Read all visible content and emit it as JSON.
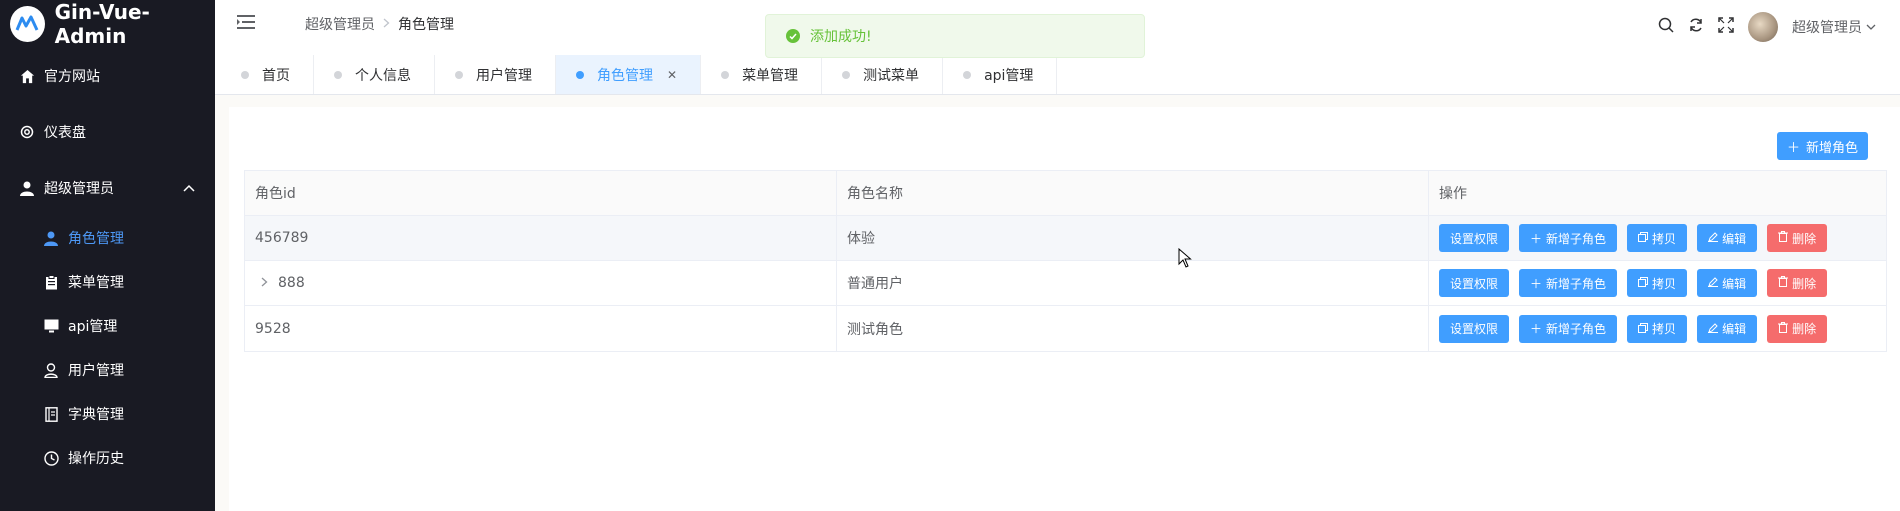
{
  "app": {
    "title": "Gin-Vue-Admin"
  },
  "sidebar": {
    "items": [
      {
        "label": "官方网站",
        "icon": "home-icon"
      },
      {
        "label": "仪表盘",
        "icon": "gear-icon"
      },
      {
        "label": "超级管理员",
        "icon": "user-icon",
        "expanded": true
      }
    ],
    "sub_items": [
      {
        "label": "角色管理",
        "icon": "user-icon",
        "active": true
      },
      {
        "label": "菜单管理",
        "icon": "clipboard-icon"
      },
      {
        "label": "api管理",
        "icon": "monitor-icon"
      },
      {
        "label": "用户管理",
        "icon": "user-outline-icon"
      },
      {
        "label": "字典管理",
        "icon": "notebook-icon"
      },
      {
        "label": "操作历史",
        "icon": "clock-icon"
      }
    ]
  },
  "header": {
    "breadcrumb": [
      "超级管理员",
      "角色管理"
    ],
    "user_name": "超级管理员"
  },
  "toast": {
    "message": "添加成功!",
    "type": "success"
  },
  "tabs": [
    {
      "label": "首页"
    },
    {
      "label": "个人信息"
    },
    {
      "label": "用户管理"
    },
    {
      "label": "角色管理",
      "active": true
    },
    {
      "label": "菜单管理"
    },
    {
      "label": "测试菜单"
    },
    {
      "label": "api管理"
    }
  ],
  "toolbar": {
    "add_role_label": "新增角色"
  },
  "table": {
    "headers": [
      "角色id",
      "角色名称",
      "操作"
    ],
    "rows": [
      {
        "id": "456789",
        "name": "体验"
      },
      {
        "id": "888",
        "name": "普通用户",
        "expandable": true
      },
      {
        "id": "9528",
        "name": "测试角色"
      }
    ],
    "actions": {
      "set_permission": "设置权限",
      "add_child": "新增子角色",
      "copy": "拷贝",
      "edit": "编辑",
      "delete": "删除"
    }
  },
  "colors": {
    "sidebar_bg": "#191a23",
    "primary": "#409eff",
    "danger": "#f56c6c",
    "success": "#67c23a"
  }
}
